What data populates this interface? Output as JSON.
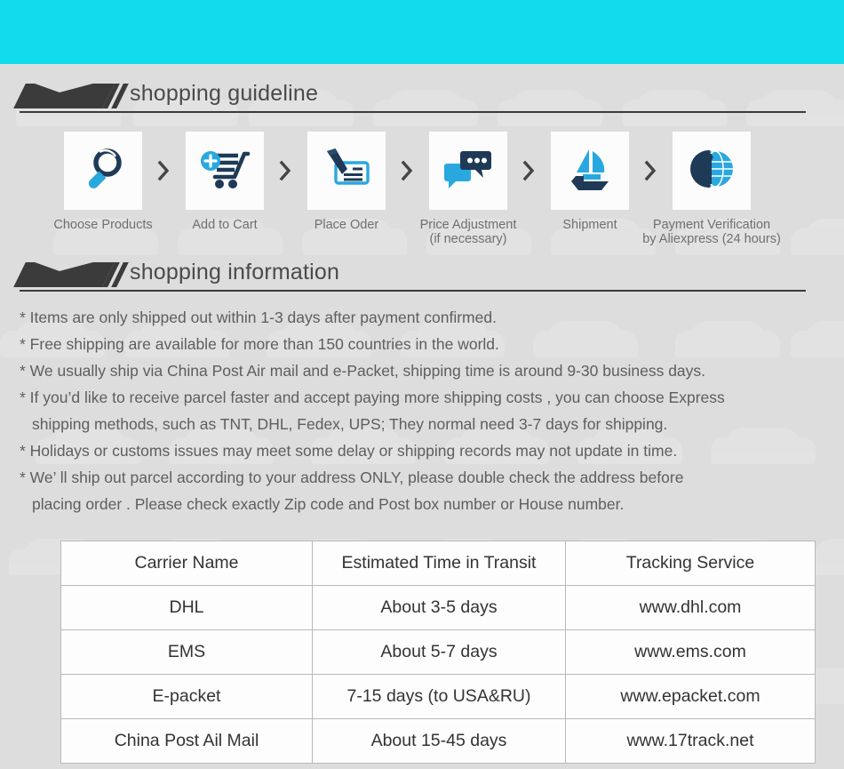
{
  "theme": {
    "banner_cyan": "#11dced",
    "background": "#dddddd",
    "heading_dark": "#3b3b3b",
    "icon_dark": "#1f3a56",
    "icon_blue": "#29a8e0",
    "text_gray": "#5e9e9e"
  },
  "guideline": {
    "heading": "shopping guideline",
    "steps": [
      {
        "icon": "magnifier-icon",
        "label_line1": "Choose Products",
        "label_line2": ""
      },
      {
        "icon": "add-to-cart-icon",
        "label_line1": "Add to Cart",
        "label_line2": ""
      },
      {
        "icon": "pen-check-icon",
        "label_line1": "Place Oder",
        "label_line2": ""
      },
      {
        "icon": "chat-bubbles-icon",
        "label_line1": "Price Adjustment",
        "label_line2": "(if necessary)"
      },
      {
        "icon": "sailboat-icon",
        "label_line1": "Shipment",
        "label_line2": ""
      },
      {
        "icon": "dollar-globe-icon",
        "label_line1": "Payment Verification",
        "label_line2": "by  Aliexpress (24 hours)"
      }
    ],
    "separator_icon": "chevron-right-icon"
  },
  "information": {
    "heading": "shopping information",
    "bullets": [
      {
        "line1": "* Items are only shipped out within 1-3 days after payment confirmed.",
        "line2": ""
      },
      {
        "line1": "* Free shipping are available for more than 150 countries in the world.",
        "line2": ""
      },
      {
        "line1": "* We usually ship via China Post Air mail and e-Packet, shipping time is around 9-30 business days.",
        "line2": ""
      },
      {
        "line1": "* If you’d like to receive parcel faster and accept paying more shipping costs , you can choose Express",
        "line2": "shipping methods, such as TNT, DHL, Fedex, UPS; They normal need 3-7 days for shipping."
      },
      {
        "line1": "* Holidays or customs issues may meet some delay or shipping records may not update in time.",
        "line2": ""
      },
      {
        "line1": "* We’ ll ship out parcel according to your address ONLY, please double check the address before",
        "line2": "placing order . Please check exactly Zip code and Post box number or House number."
      }
    ]
  },
  "carrier_table": {
    "headers": [
      "Carrier Name",
      "Estimated Time in Transit",
      "Tracking Service"
    ],
    "rows": [
      [
        "DHL",
        "About 3-5 days",
        "www.dhl.com"
      ],
      [
        "EMS",
        "About 5-7 days",
        "www.ems.com"
      ],
      [
        "E-packet",
        "7-15 days (to USA&RU)",
        "www.epacket.com"
      ],
      [
        "China Post Ail Mail",
        "About 15-45 days",
        "www.17track.net"
      ]
    ]
  }
}
